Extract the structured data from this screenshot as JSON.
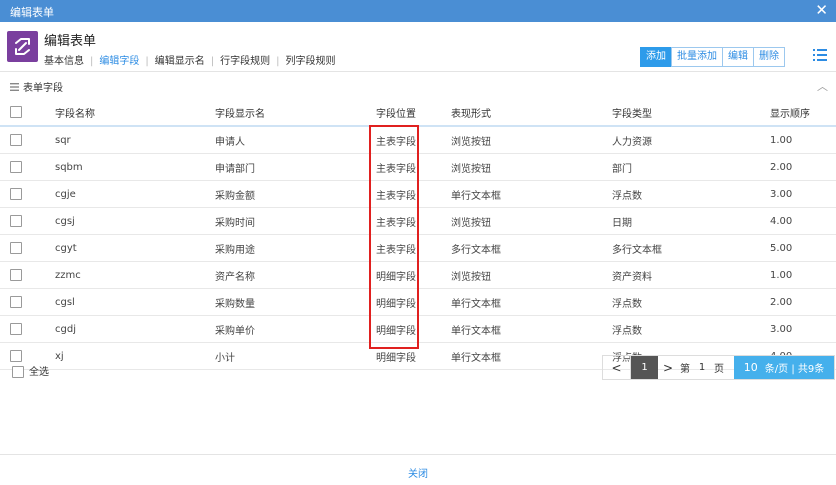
{
  "window": {
    "title": "编辑表单"
  },
  "app": {
    "title": "编辑表单"
  },
  "tabs": [
    {
      "label": "基本信息"
    },
    {
      "label": "编辑字段"
    },
    {
      "label": "编辑显示名"
    },
    {
      "label": "行字段规则"
    },
    {
      "label": "列字段规则"
    }
  ],
  "toolbar": {
    "add": "添加",
    "batch_add": "批量添加",
    "edit": "编辑",
    "delete": "删除"
  },
  "section": {
    "title": "表单字段"
  },
  "table": {
    "headers": [
      "字段名称",
      "字段显示名",
      "字段位置",
      "表现形式",
      "字段类型",
      "显示顺序"
    ],
    "rows": [
      [
        "sqr",
        "申请人",
        "主表字段",
        "浏览按钮",
        "人力资源",
        "1.00"
      ],
      [
        "sqbm",
        "申请部门",
        "主表字段",
        "浏览按钮",
        "部门",
        "2.00"
      ],
      [
        "cgje",
        "采购金额",
        "主表字段",
        "单行文本框",
        "浮点数",
        "3.00"
      ],
      [
        "cgsj",
        "采购时间",
        "主表字段",
        "浏览按钮",
        "日期",
        "4.00"
      ],
      [
        "cgyt",
        "采购用途",
        "主表字段",
        "多行文本框",
        "多行文本框",
        "5.00"
      ],
      [
        "zzmc",
        "资产名称",
        "明细字段",
        "浏览按钮",
        "资产资料",
        "1.00"
      ],
      [
        "cgsl",
        "采购数量",
        "明细字段",
        "单行文本框",
        "浮点数",
        "2.00"
      ],
      [
        "cgdj",
        "采购单价",
        "明细字段",
        "单行文本框",
        "浮点数",
        "3.00"
      ],
      [
        "xj",
        "小计",
        "明细字段",
        "单行文本框",
        "浮点数",
        "4.00"
      ]
    ]
  },
  "footer": {
    "select_all": "全选"
  },
  "pager": {
    "prev": "<",
    "current": "1",
    "next": ">",
    "label_di": "第",
    "page_input": "1",
    "label_ye": "页",
    "per_page": "10",
    "per_page_suffix": "条/页 | 共9条"
  },
  "dialog": {
    "close": "关闭"
  },
  "colors": {
    "titlebar": "#4a8ed4",
    "accent": "#2d9bea",
    "app_icon": "#7a3f9e",
    "highlight": "#e0201f"
  }
}
